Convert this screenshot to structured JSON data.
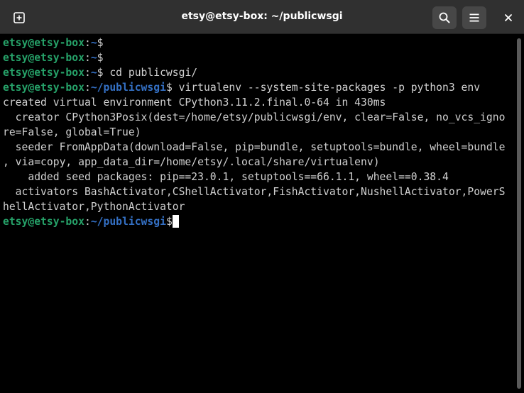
{
  "window": {
    "title": "etsy@etsy-box: ~/publicwsgi"
  },
  "icons": {
    "new_tab": "new-tab-plus-icon",
    "search": "search-icon",
    "menu": "hamburger-menu-icon",
    "close": "close-icon"
  },
  "colors": {
    "prompt_user": "#26a269",
    "prompt_path": "#3470c4",
    "text": "#d0d0d0",
    "headerbar": "#303030",
    "background": "#000000"
  },
  "terminal": {
    "lines": [
      {
        "type": "prompt",
        "user": "etsy@etsy-box",
        "sep": ":",
        "path": "~",
        "sym": "$",
        "cmd": ""
      },
      {
        "type": "prompt",
        "user": "etsy@etsy-box",
        "sep": ":",
        "path": "~",
        "sym": "$",
        "cmd": ""
      },
      {
        "type": "prompt",
        "user": "etsy@etsy-box",
        "sep": ":",
        "path": "~",
        "sym": "$",
        "cmd": " cd publicwsgi/"
      },
      {
        "type": "prompt",
        "user": "etsy@etsy-box",
        "sep": ":",
        "path": "~/publicwsgi",
        "sym": "$",
        "cmd": " virtualenv --system-site-packages -p python3 env"
      },
      {
        "type": "output",
        "text": "created virtual environment CPython3.11.2.final.0-64 in 430ms"
      },
      {
        "type": "output",
        "text": "  creator CPython3Posix(dest=/home/etsy/publicwsgi/env, clear=False, no_vcs_igno"
      },
      {
        "type": "output",
        "text": "re=False, global=True)"
      },
      {
        "type": "output",
        "text": "  seeder FromAppData(download=False, pip=bundle, setuptools=bundle, wheel=bundle"
      },
      {
        "type": "output",
        "text": ", via=copy, app_data_dir=/home/etsy/.local/share/virtualenv)"
      },
      {
        "type": "output",
        "text": "    added seed packages: pip==23.0.1, setuptools==66.1.1, wheel==0.38.4"
      },
      {
        "type": "output",
        "text": "  activators BashActivator,CShellActivator,FishActivator,NushellActivator,PowerS"
      },
      {
        "type": "output",
        "text": "hellActivator,PythonActivator"
      },
      {
        "type": "prompt",
        "user": "etsy@etsy-box",
        "sep": ":",
        "path": "~/publicwsgi",
        "sym": "$",
        "cmd": "",
        "cursor": true
      }
    ]
  }
}
